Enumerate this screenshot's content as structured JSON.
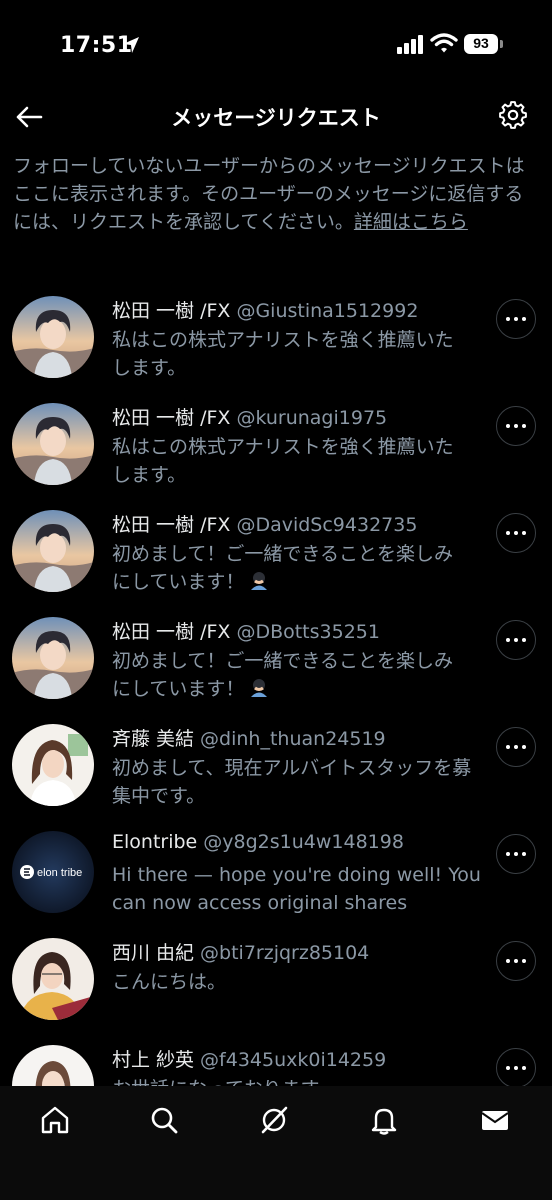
{
  "status": {
    "time": "17:51",
    "battery": "93"
  },
  "header": {
    "title": "メッセージリクエスト"
  },
  "info": {
    "text": "フォローしていないユーザーからのメッセージリクエストはここに表示されます。そのユーザーのメッセージに返信するには、リクエストを承認してください。",
    "link": "詳細はこちら"
  },
  "requests": [
    {
      "name": "松田 一樹 /FX",
      "handle": "@Giustina1512992",
      "msg": "私はこの株式アナリストを強く推薦いたします。"
    },
    {
      "name": "松田 一樹 /FX",
      "handle": "@kurunagi1975",
      "msg": "私はこの株式アナリストを強く推薦いたします。"
    },
    {
      "name": "松田 一樹 /FX",
      "handle": "@DavidSc9432735",
      "msg": "初めまして！ご一緒できることを楽しみにしています！"
    },
    {
      "name": "松田 一樹 /FX",
      "handle": "@DBotts35251",
      "msg": "初めまして！ご一緒できることを楽しみにしています！"
    },
    {
      "name": "斉藤 美結",
      "handle": "@dinh_thuan24519",
      "msg": "初めまして、現在アルバイトスタッフを募集中です。"
    },
    {
      "name": "Elontribe",
      "handle": "@y8g2s1u4w148198",
      "msg": "Hi there — hope you're doing well! You can now access original shares"
    },
    {
      "name": "西川 由紀",
      "handle": "@bti7rzjqrz85104",
      "msg": "こんにちは。"
    },
    {
      "name": "村上 紗英",
      "handle": "@f4345uxk0i14259",
      "msg": "お世話になっております。"
    }
  ],
  "avatar_logo": "elon tribe",
  "icons": {
    "nav": [
      "home-icon",
      "search-icon",
      "grok-icon",
      "notifications-icon",
      "messages-icon"
    ]
  }
}
